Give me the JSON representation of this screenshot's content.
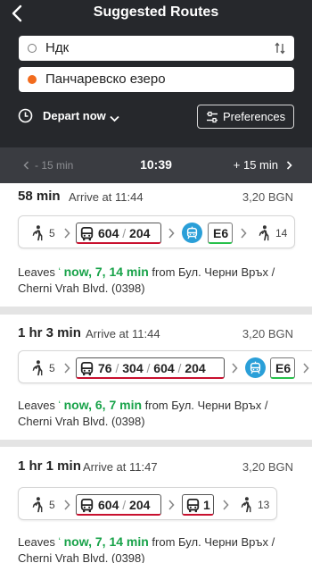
{
  "header": {
    "title": "Suggested Routes",
    "from": "Ндк",
    "to": "Панчаревско езеро",
    "depart_label": "Depart now",
    "preferences_label": "Preferences"
  },
  "timebar": {
    "earlier": "- 15 min",
    "current": "10:39",
    "later": "+ 15 min"
  },
  "colors": {
    "header_bg": "#26282c",
    "destination_dot": "#f26b1d",
    "realtime_green": "#19a34a",
    "bus_line_underline": "#c8102e",
    "tram_line_underline": "#26c04a",
    "tram_icon_bg": "#2a9fd8"
  },
  "routes": [
    {
      "duration": "58 min",
      "arrive": "Arrive at 11:44",
      "price": "3,20 BGN",
      "walk_start": "5",
      "bus1_a": "604",
      "bus1_b": "204",
      "tram_line": "E6",
      "walk_end": "14",
      "leaves_label": "Leaves",
      "leaves_times": "now, 7, 14 min",
      "leaves_from": "from Бул. Черни Връх /",
      "leaves_stop": "Cherni Vrah Blvd. (0398)"
    },
    {
      "duration": "1 hr 3 min",
      "arrive": "Arrive at 11:44",
      "price": "3,20 BGN",
      "walk_start": "5",
      "bus_lines": [
        "76",
        "304",
        "604",
        "204"
      ],
      "tram_line": "E6",
      "leaves_label": "Leaves",
      "leaves_times": "now, 6, 7 min",
      "leaves_from": "from Бул. Черни Връх /",
      "leaves_stop": "Cherni Vrah Blvd. (0398)"
    },
    {
      "duration": "1 hr 1 min",
      "arrive": "Arrive at 11:47",
      "price": "3,20 BGN",
      "walk_start": "5",
      "bus1_a": "604",
      "bus1_b": "204",
      "bus2": "1",
      "walk_end": "13",
      "leaves_label": "Leaves",
      "leaves_times": "now, 7, 14 min",
      "leaves_from": "from Бул. Черни Връх /",
      "leaves_stop": "Cherni Vrah Blvd. (0398)"
    }
  ]
}
